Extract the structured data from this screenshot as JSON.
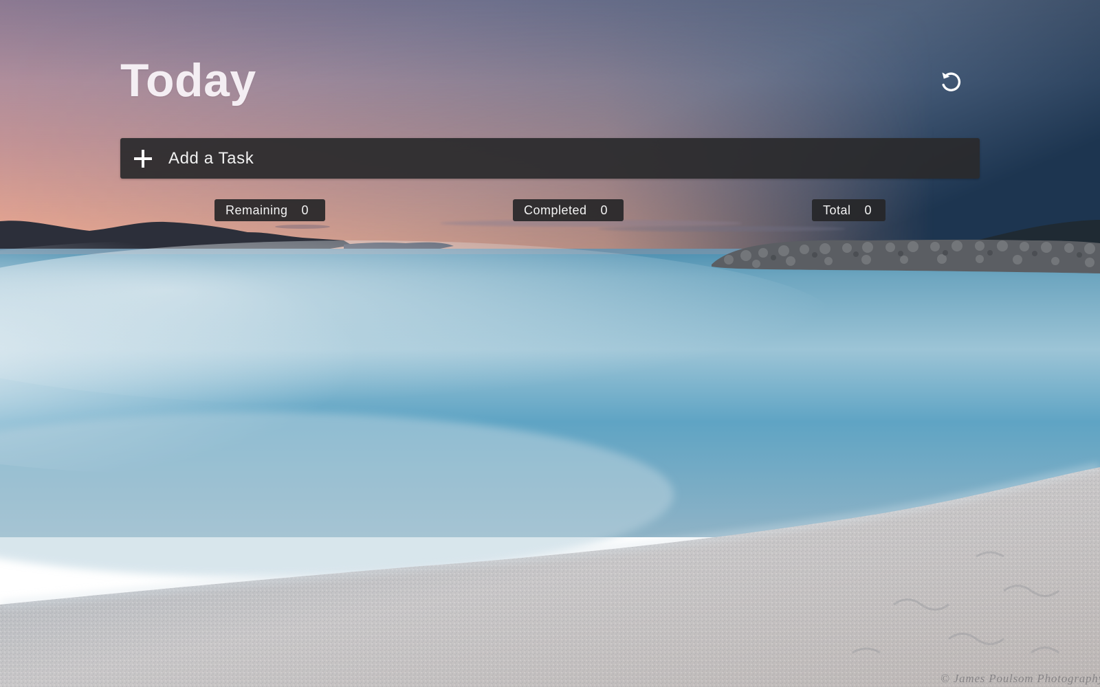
{
  "page": {
    "title": "Today"
  },
  "toolbar": {
    "refresh_icon": "refresh-icon"
  },
  "add_task": {
    "icon": "plus-icon",
    "placeholder": "Add a Task",
    "value": ""
  },
  "stats": {
    "remaining_label": "Remaining",
    "remaining_count": "0",
    "completed_label": "Completed",
    "completed_count": "0",
    "total_label": "Total",
    "total_count": "0"
  },
  "background": {
    "credit": "© James Poulsom Photography"
  },
  "colors": {
    "panel": "#2a2a2c",
    "text": "#f3f3f3",
    "title": "#f4eef3"
  }
}
